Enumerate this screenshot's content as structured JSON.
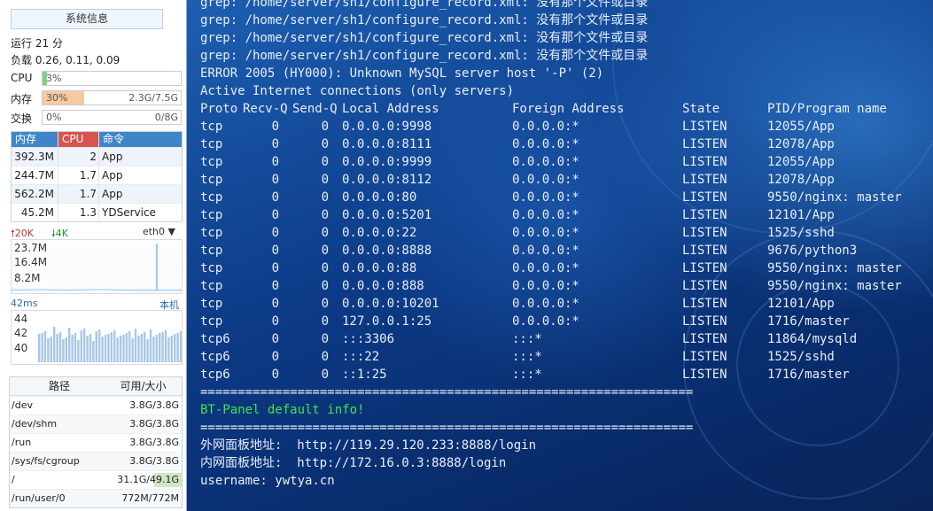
{
  "sidebar": {
    "sysinfo_button": "系统信息",
    "uptime": "运行 21 分",
    "load": "负载 0.26, 0.11, 0.09",
    "cpu": {
      "label": "CPU",
      "pct": "3%",
      "fraction": 0.03,
      "color": "#7fd17f"
    },
    "mem": {
      "label": "内存",
      "pct": "30%",
      "detail": "2.3G/7.5G",
      "fraction": 0.3,
      "color": "#f7c9a0"
    },
    "swap": {
      "label": "交换",
      "pct": "0%",
      "detail": "0/8G",
      "fraction": 0.0
    },
    "process_table": {
      "headers": {
        "mem": "内存",
        "cpu": "CPU",
        "cmd": "命令"
      },
      "header_colors": {
        "mem": "#3f86c9",
        "cpu": "#d9534f",
        "cmd": "#3f86c9"
      },
      "rows": [
        {
          "mem": "392.3M",
          "cpu": "2",
          "cmd": "App"
        },
        {
          "mem": "244.7M",
          "cpu": "1.7",
          "cmd": "App"
        },
        {
          "mem": "562.2M",
          "cpu": "1.7",
          "cmd": "App"
        },
        {
          "mem": "45.2M",
          "cpu": "1.3",
          "cmd": "YDService"
        }
      ]
    },
    "network": {
      "up": "🠕20K",
      "down": "🠗4K",
      "interface": "eth0",
      "labels": [
        "23.7M",
        "16.4M",
        "8.2M"
      ]
    },
    "ping": {
      "label": "42ms",
      "host": "本机",
      "labels": [
        "44",
        "42",
        "40"
      ]
    },
    "disk_table": {
      "headers": {
        "path": "路径",
        "size": "可用/大小"
      },
      "rows": [
        {
          "path": "/dev",
          "size": "3.8G/3.8G"
        },
        {
          "path": "/dev/shm",
          "size": "3.8G/3.8G"
        },
        {
          "path": "/run",
          "size": "3.8G/3.8G"
        },
        {
          "path": "/sys/fs/cgroup",
          "size": "3.8G/3.8G"
        },
        {
          "path": "/",
          "size": "31.1G/49.1G",
          "used_fraction": 0.37
        },
        {
          "path": "/run/user/0",
          "size": "772M/772M"
        }
      ]
    }
  },
  "terminal": {
    "lines_pre": [
      "grep: /home/server/sh1/configure_record.xml: 没有那个文件或目录",
      "grep: /home/server/sh1/configure_record.xml: 没有那个文件或目录",
      "grep: /home/server/sh1/configure_record.xml: 没有那个文件或目录",
      "grep: /home/server/sh1/configure_record.xml: 没有那个文件或目录",
      "ERROR 2005 (HY000): Unknown MySQL server host '-P' (2)",
      "Active Internet connections (only servers)"
    ],
    "netstat_header": {
      "proto": "Proto",
      "recvq": "Recv-Q",
      "sendq": "Send-Q",
      "local": "Local Address",
      "foreign": "Foreign Address",
      "state": "State",
      "pid": "PID/Program name"
    },
    "netstat_rows": [
      {
        "proto": "tcp",
        "recvq": "0",
        "sendq": "0",
        "local": "0.0.0.0:9998",
        "foreign": "0.0.0.0:*",
        "state": "LISTEN",
        "pid": "12055/App"
      },
      {
        "proto": "tcp",
        "recvq": "0",
        "sendq": "0",
        "local": "0.0.0.0:8111",
        "foreign": "0.0.0.0:*",
        "state": "LISTEN",
        "pid": "12078/App"
      },
      {
        "proto": "tcp",
        "recvq": "0",
        "sendq": "0",
        "local": "0.0.0.0:9999",
        "foreign": "0.0.0.0:*",
        "state": "LISTEN",
        "pid": "12055/App"
      },
      {
        "proto": "tcp",
        "recvq": "0",
        "sendq": "0",
        "local": "0.0.0.0:8112",
        "foreign": "0.0.0.0:*",
        "state": "LISTEN",
        "pid": "12078/App"
      },
      {
        "proto": "tcp",
        "recvq": "0",
        "sendq": "0",
        "local": "0.0.0.0:80",
        "foreign": "0.0.0.0:*",
        "state": "LISTEN",
        "pid": "9550/nginx: master"
      },
      {
        "proto": "tcp",
        "recvq": "0",
        "sendq": "0",
        "local": "0.0.0.0:5201",
        "foreign": "0.0.0.0:*",
        "state": "LISTEN",
        "pid": "12101/App"
      },
      {
        "proto": "tcp",
        "recvq": "0",
        "sendq": "0",
        "local": "0.0.0.0:22",
        "foreign": "0.0.0.0:*",
        "state": "LISTEN",
        "pid": "1525/sshd"
      },
      {
        "proto": "tcp",
        "recvq": "0",
        "sendq": "0",
        "local": "0.0.0.0:8888",
        "foreign": "0.0.0.0:*",
        "state": "LISTEN",
        "pid": "9676/python3"
      },
      {
        "proto": "tcp",
        "recvq": "0",
        "sendq": "0",
        "local": "0.0.0.0:88",
        "foreign": "0.0.0.0:*",
        "state": "LISTEN",
        "pid": "9550/nginx: master"
      },
      {
        "proto": "tcp",
        "recvq": "0",
        "sendq": "0",
        "local": "0.0.0.0:888",
        "foreign": "0.0.0.0:*",
        "state": "LISTEN",
        "pid": "9550/nginx: master"
      },
      {
        "proto": "tcp",
        "recvq": "0",
        "sendq": "0",
        "local": "0.0.0.0:10201",
        "foreign": "0.0.0.0:*",
        "state": "LISTEN",
        "pid": "12101/App"
      },
      {
        "proto": "tcp",
        "recvq": "0",
        "sendq": "0",
        "local": "127.0.0.1:25",
        "foreign": "0.0.0.0:*",
        "state": "LISTEN",
        "pid": "1716/master"
      },
      {
        "proto": "tcp6",
        "recvq": "0",
        "sendq": "0",
        "local": ":::3306",
        "foreign": ":::*",
        "state": "LISTEN",
        "pid": "11864/mysqld"
      },
      {
        "proto": "tcp6",
        "recvq": "0",
        "sendq": "0",
        "local": ":::22",
        "foreign": ":::*",
        "state": "LISTEN",
        "pid": "1525/sshd"
      },
      {
        "proto": "tcp6",
        "recvq": "0",
        "sendq": "0",
        "local": "::1:25",
        "foreign": ":::*",
        "state": "LISTEN",
        "pid": "1716/master"
      }
    ],
    "separator": "==================================================================",
    "bt_panel_info": "BT-Panel default info!",
    "external_url": "外网面板地址:  http://119.29.120.233:8888/login",
    "internal_url": "内网面板地址:  http://172.16.0.3:8888/login",
    "username": "username: ywtya.cn",
    "accent_green": "#3fe34a"
  }
}
